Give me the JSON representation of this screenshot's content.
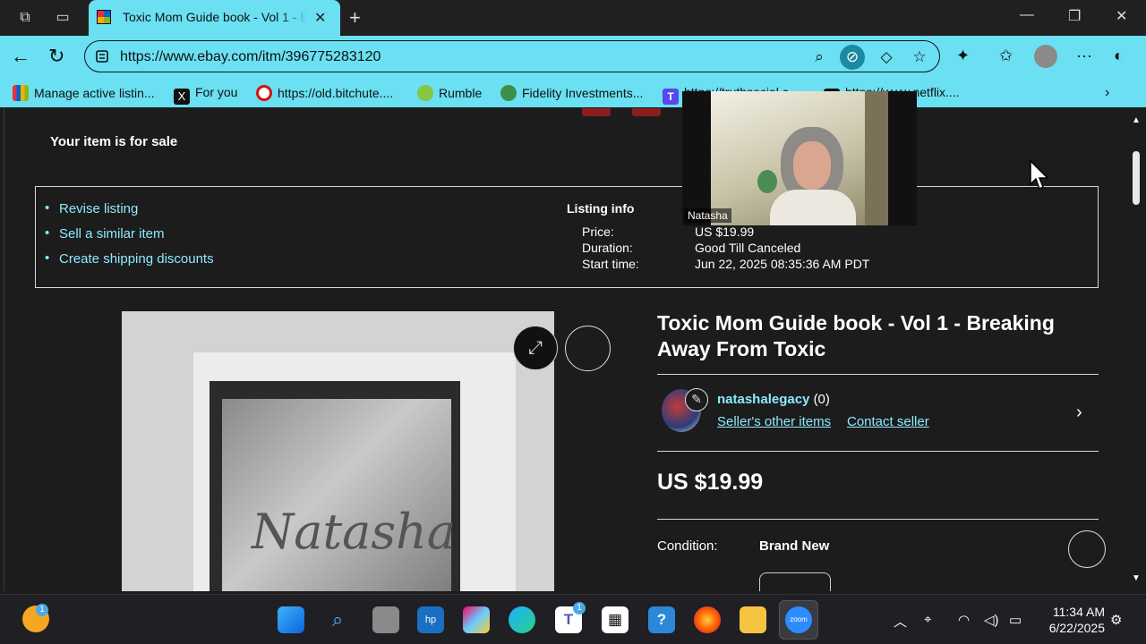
{
  "browser": {
    "tab_title": "Toxic Mom Guide book - Vol 1 - Breaking Away From Toxic",
    "url": "https://www.ebay.com/itm/396775283120",
    "bookmarks": [
      {
        "label": "Manage active listin..."
      },
      {
        "label": "For you"
      },
      {
        "label": "https://old.bitchute...."
      },
      {
        "label": "Rumble"
      },
      {
        "label": "Fidelity Investments..."
      },
      {
        "label": "https://truthsocial.c..."
      },
      {
        "label": "https://www.netflix...."
      }
    ]
  },
  "page": {
    "for_sale_text": "Your item is for sale",
    "actions": [
      "Revise listing",
      "Sell a similar item",
      "Create shipping discounts"
    ],
    "listing_info": {
      "title": "Listing info",
      "price_label": "Price:",
      "price_value": "US $19.99",
      "duration_label": "Duration:",
      "duration_value": "Good Till Canceled",
      "start_label": "Start time:",
      "start_value": "Jun 22, 2025 08:35:36 AM PDT"
    },
    "item": {
      "title": "Toxic Mom Guide book - Vol 1 - Breaking Away From Toxic",
      "seller_name": "natashalegacy",
      "seller_score": "(0)",
      "seller_other_items": "Seller's other items",
      "contact_seller": "Contact seller",
      "price": "US $19.99",
      "condition_label": "Condition:",
      "condition_value": "Brand New",
      "photo_signature": "Natasha"
    }
  },
  "video_overlay": {
    "participant_name": "Natasha"
  },
  "taskbar": {
    "time": "11:34 AM",
    "date": "6/22/2025",
    "teams_badge": "1",
    "app_badge": "1"
  },
  "colors": {
    "accent": "#6ae0f2",
    "link": "#8ee9ff",
    "page_bg": "#1c1c1c"
  }
}
